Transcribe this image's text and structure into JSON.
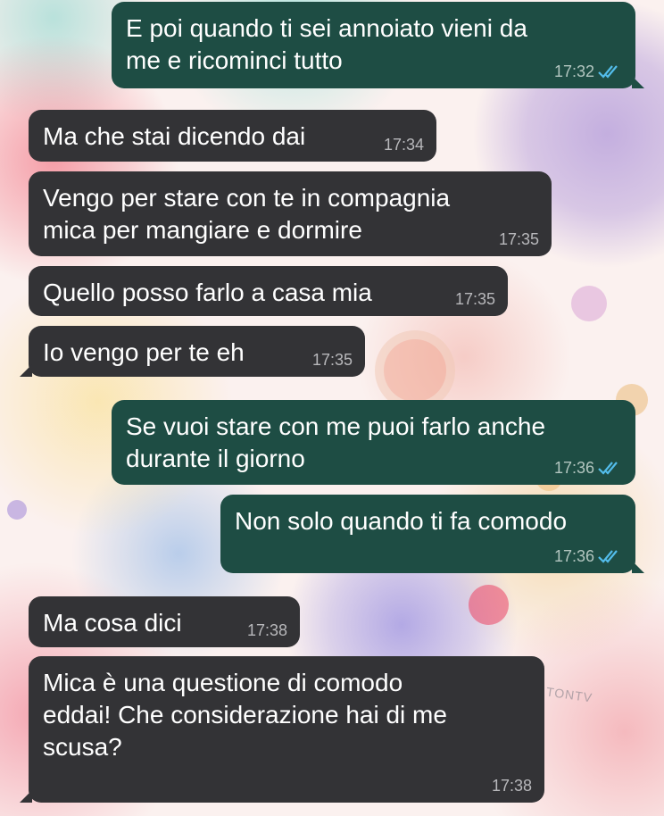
{
  "colors": {
    "outgoing_bubble": "#1e4d44",
    "incoming_bubble": "#333336",
    "read_ticks": "#53bdeb",
    "time_out": "#b3c6c0",
    "time_in": "#b8b8bb"
  },
  "watermark": "TONTV",
  "messages": [
    {
      "direction": "outgoing",
      "text": "E poi quando ti sei annoiato vieni da\nme e ricominci tutto",
      "time": "17:32",
      "status": "read"
    },
    {
      "direction": "incoming",
      "text": "Ma che stai dicendo dai",
      "time": "17:34"
    },
    {
      "direction": "incoming",
      "text": "Vengo per stare con te in compagnia\nmica per mangiare e dormire",
      "time": "17:35"
    },
    {
      "direction": "incoming",
      "text": "Quello posso farlo a casa mia",
      "time": "17:35"
    },
    {
      "direction": "incoming",
      "text": "Io vengo per te eh",
      "time": "17:35"
    },
    {
      "direction": "outgoing",
      "text": "Se vuoi stare con me puoi farlo anche\ndurante il giorno",
      "time": "17:36",
      "status": "read"
    },
    {
      "direction": "outgoing",
      "text": "Non solo quando ti fa comodo",
      "time": "17:36",
      "status": "read"
    },
    {
      "direction": "incoming",
      "text": "Ma cosa dici",
      "time": "17:38"
    },
    {
      "direction": "incoming",
      "text": "Mica è una questione di comodo\neddai! Che considerazione hai di me\nscusa?",
      "time": "17:38"
    }
  ]
}
